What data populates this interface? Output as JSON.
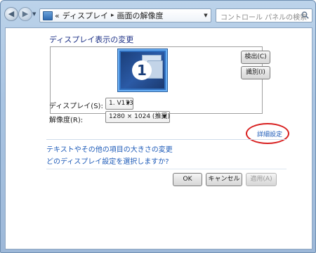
{
  "breadcrumb": {
    "prefix": "«",
    "item1": "ディスプレイ",
    "separator": "▸",
    "item2": "画面の解像度"
  },
  "search": {
    "placeholder": "コントロール パネルの検索"
  },
  "main": {
    "heading": "ディスプレイ表示の変更",
    "monitor_number": "1",
    "detect_label": "検出(C)",
    "identify_label": "識別(I)",
    "display_label": "ディスプレイ(S):",
    "display_value": "1. V173",
    "resolution_label": "解像度(R):",
    "resolution_value": "1280 × 1024 (推奨)",
    "advanced_link": "詳細設定",
    "text_size_link": "テキストやその他の項目の大きさの変更",
    "which_settings_link": "どのディスプレイ設定を選択しますか?"
  },
  "buttons": {
    "ok": "OK",
    "cancel": "キャンセル",
    "apply": "適用(A)"
  },
  "colors": {
    "accent_link": "#1e5bb8",
    "heading": "#1e3287",
    "highlight_circle": "#d81f1f",
    "monitor": "#2f6fbf"
  }
}
